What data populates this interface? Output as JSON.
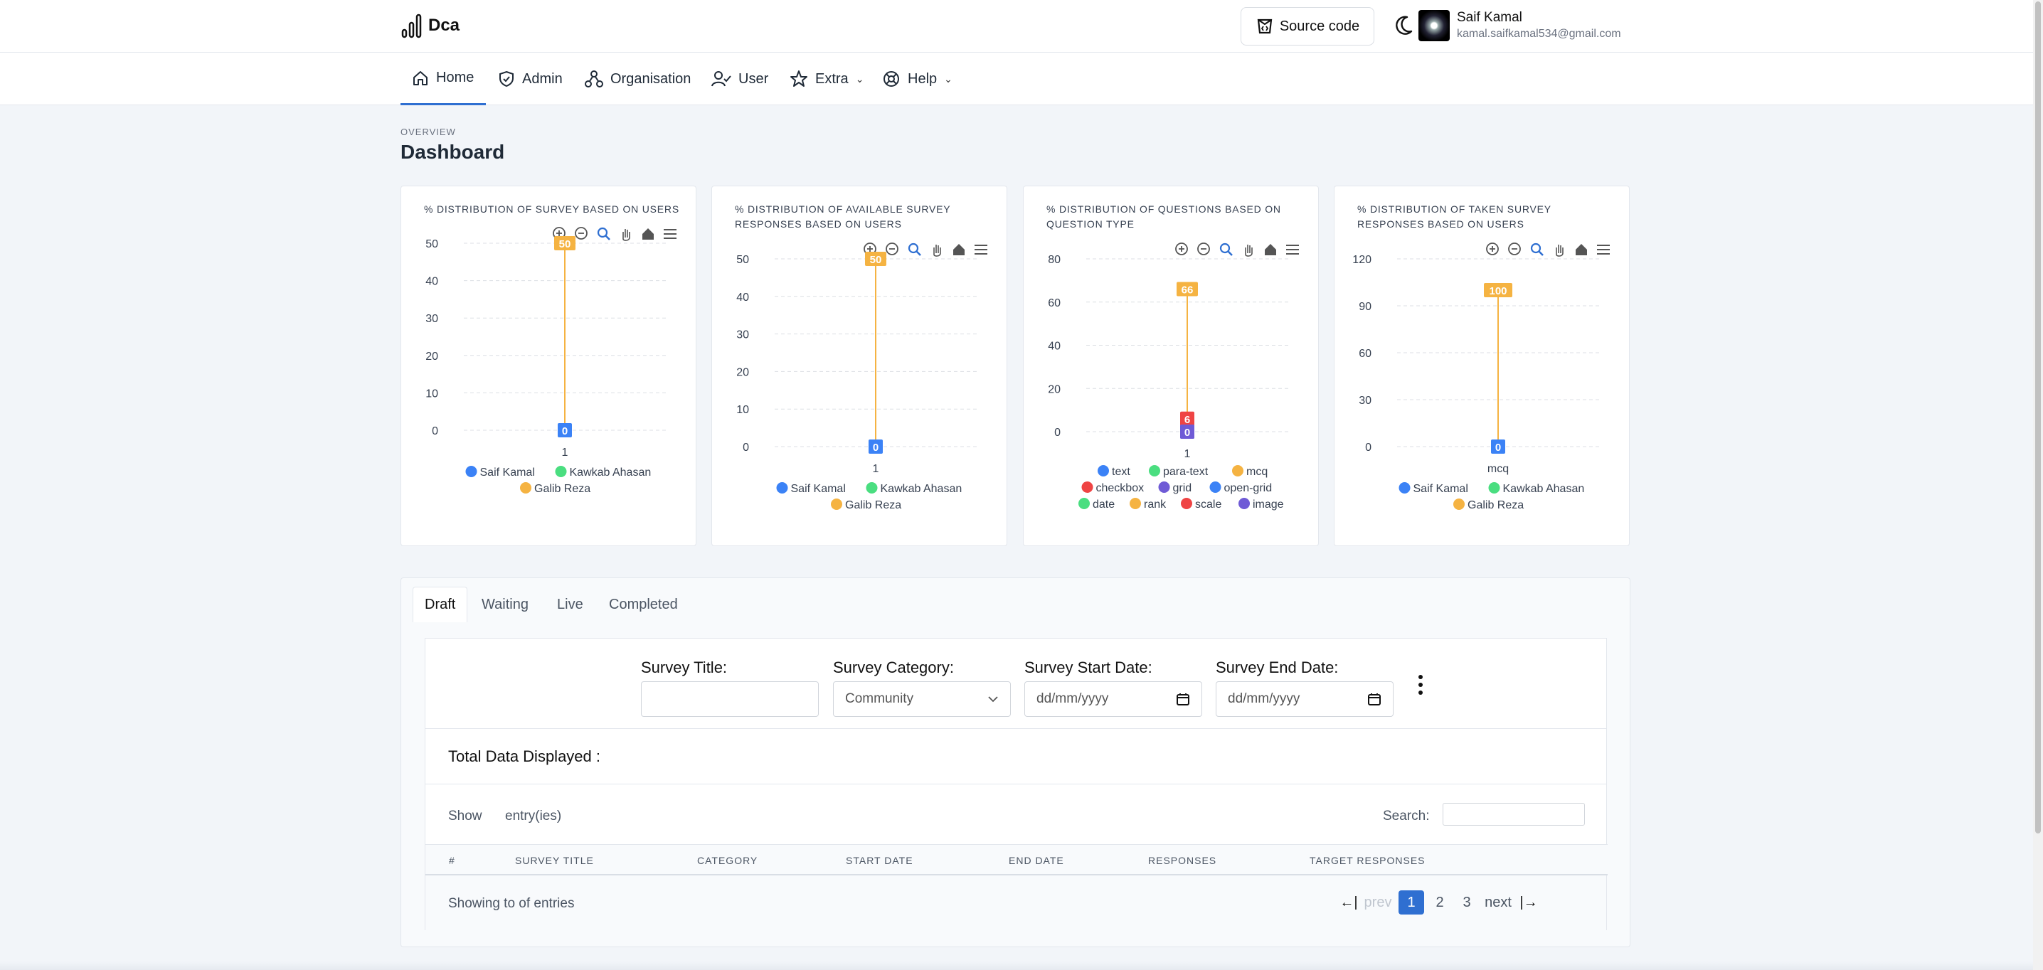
{
  "app": {
    "logo_text": "Dca"
  },
  "header": {
    "source_code_label": "Source code",
    "user_name": "Saif Kamal",
    "user_email": "kamal.saifkamal534@gmail.com"
  },
  "nav": {
    "items": [
      {
        "label": "Home",
        "icon": "home-icon"
      },
      {
        "label": "Admin",
        "icon": "shield-check-icon"
      },
      {
        "label": "Organisation",
        "icon": "organisation-icon"
      },
      {
        "label": "User",
        "icon": "user-check-icon"
      },
      {
        "label": "Extra",
        "icon": "star-icon"
      },
      {
        "label": "Help",
        "icon": "lifebuoy-icon"
      }
    ],
    "active": "Home"
  },
  "page": {
    "overline": "OVERVIEW",
    "title": "Dashboard"
  },
  "colors": {
    "blue": "#3b82f6",
    "green": "#4ade80",
    "orange": "#f5b342",
    "red": "#ef4444",
    "purple": "#6f5bd6",
    "accent": "#2f6fd1"
  },
  "chart_data": [
    {
      "type": "bar",
      "title": "% DISTRIBUTION OF SURVEY BASED ON USERS",
      "categories": [
        "1"
      ],
      "series": [
        {
          "name": "Saif Kamal",
          "values": [
            0
          ],
          "color": "#3b82f6"
        },
        {
          "name": "Kawkab Ahasan",
          "values": [
            0
          ],
          "color": "#4ade80"
        },
        {
          "name": "Galib Reza",
          "values": [
            50
          ],
          "color": "#f5b342"
        }
      ],
      "data_labels": [
        "0",
        "50"
      ],
      "yticks": [
        "0",
        "10",
        "20",
        "30",
        "40",
        "50"
      ],
      "ylim": [
        0,
        50
      ]
    },
    {
      "type": "bar",
      "title": "% DISTRIBUTION OF AVAILABLE SURVEY RESPONSES BASED ON USERS",
      "categories": [
        "1"
      ],
      "series": [
        {
          "name": "Saif Kamal",
          "values": [
            0
          ],
          "color": "#3b82f6"
        },
        {
          "name": "Kawkab Ahasan",
          "values": [
            0
          ],
          "color": "#4ade80"
        },
        {
          "name": "Galib Reza",
          "values": [
            50
          ],
          "color": "#f5b342"
        }
      ],
      "data_labels": [
        "0",
        "50"
      ],
      "yticks": [
        "0",
        "10",
        "20",
        "30",
        "40",
        "50"
      ],
      "ylim": [
        0,
        50
      ]
    },
    {
      "type": "bar",
      "title": "% DISTRIBUTION OF QUESTIONS BASED ON QUESTION TYPE",
      "categories": [
        "1"
      ],
      "series": [
        {
          "name": "text",
          "values": [
            0
          ],
          "color": "#3b82f6"
        },
        {
          "name": "para-text",
          "values": [
            0
          ],
          "color": "#4ade80"
        },
        {
          "name": "mcq",
          "values": [
            66
          ],
          "color": "#f5b342"
        },
        {
          "name": "checkbox",
          "values": [
            6
          ],
          "color": "#ef4444"
        },
        {
          "name": "grid",
          "values": [
            0
          ],
          "color": "#6f5bd6"
        },
        {
          "name": "open-grid",
          "values": [
            0
          ],
          "color": "#3b82f6"
        },
        {
          "name": "date",
          "values": [
            0
          ],
          "color": "#4ade80"
        },
        {
          "name": "rank",
          "values": [
            0
          ],
          "color": "#f5b342"
        },
        {
          "name": "scale",
          "values": [
            0
          ],
          "color": "#ef4444"
        },
        {
          "name": "image",
          "values": [
            0
          ],
          "color": "#6f5bd6"
        }
      ],
      "data_labels": [
        "0",
        "6",
        "66"
      ],
      "yticks": [
        "0",
        "20",
        "40",
        "60",
        "80"
      ],
      "ylim": [
        0,
        80
      ]
    },
    {
      "type": "bar",
      "title": "% DISTRIBUTION OF TAKEN SURVEY RESPONSES BASED ON USERS",
      "categories": [
        "mcq"
      ],
      "series": [
        {
          "name": "Saif Kamal",
          "values": [
            0
          ],
          "color": "#3b82f6"
        },
        {
          "name": "Kawkab Ahasan",
          "values": [
            0
          ],
          "color": "#4ade80"
        },
        {
          "name": "Galib Reza",
          "values": [
            100
          ],
          "color": "#f5b342"
        }
      ],
      "data_labels": [
        "0",
        "100"
      ],
      "yticks": [
        "0",
        "30",
        "60",
        "90",
        "120"
      ],
      "ylim": [
        0,
        120
      ]
    }
  ],
  "tabs": [
    "Draft",
    "Waiting",
    "Live",
    "Completed"
  ],
  "filters": {
    "title_label": "Survey Title:",
    "title_value": "",
    "category_label": "Survey Category:",
    "category_value": "Community",
    "start_label": "Survey Start Date:",
    "start_placeholder": "dd/mm/yyyy",
    "end_label": "Survey End Date:",
    "end_placeholder": "dd/mm/yyyy"
  },
  "table": {
    "total_label": "Total Data Displayed :",
    "show_label": "Show",
    "entries_label": "entry(ies)",
    "search_label": "Search:",
    "columns": [
      "#",
      "SURVEY TITLE",
      "CATEGORY",
      "START DATE",
      "END DATE",
      "RESPONSES",
      "TARGET RESPONSES"
    ],
    "showing_text": "Showing to of entries"
  },
  "pagination": {
    "first": "←|",
    "prev": "prev",
    "pages": [
      "1",
      "2",
      "3"
    ],
    "current": "1",
    "next": "next",
    "last": "|→"
  }
}
